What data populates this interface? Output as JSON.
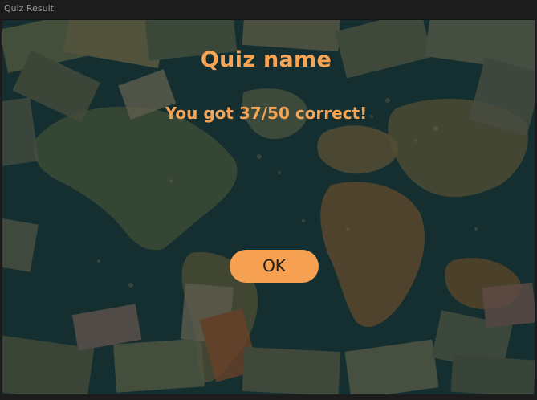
{
  "window": {
    "title": "Quiz Result"
  },
  "quiz": {
    "name": "Quiz name",
    "result_text": "You got 37/50 correct!",
    "ok_label": "OK"
  },
  "background": {
    "description_icon": "world-map-money-image"
  },
  "colors": {
    "accent": "#f6a455",
    "button_bg": "#f6a052",
    "window_bg": "#1c1c1c",
    "ocean": "#153033"
  }
}
